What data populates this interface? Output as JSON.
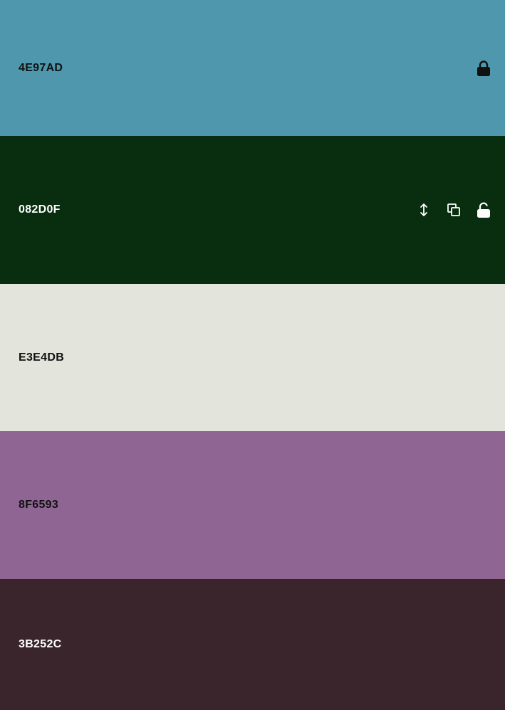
{
  "swatches": [
    {
      "hex": "4E97AD",
      "color": "#4E97AD",
      "text_color": "#111111",
      "icons": [
        "lock-closed-icon"
      ]
    },
    {
      "hex": "082D0F",
      "color": "#082D0F",
      "text_color": "#FFFFFF",
      "icons": [
        "drag-vertical-icon",
        "copy-icon",
        "lock-open-icon"
      ]
    },
    {
      "hex": "E3E4DB",
      "color": "#E3E4DB",
      "text_color": "#111111",
      "icons": []
    },
    {
      "hex": "8F6593",
      "color": "#8F6593",
      "text_color": "#111111",
      "icons": []
    },
    {
      "hex": "3B252C",
      "color": "#3B252C",
      "text_color": "#FFFFFF",
      "icons": []
    }
  ]
}
